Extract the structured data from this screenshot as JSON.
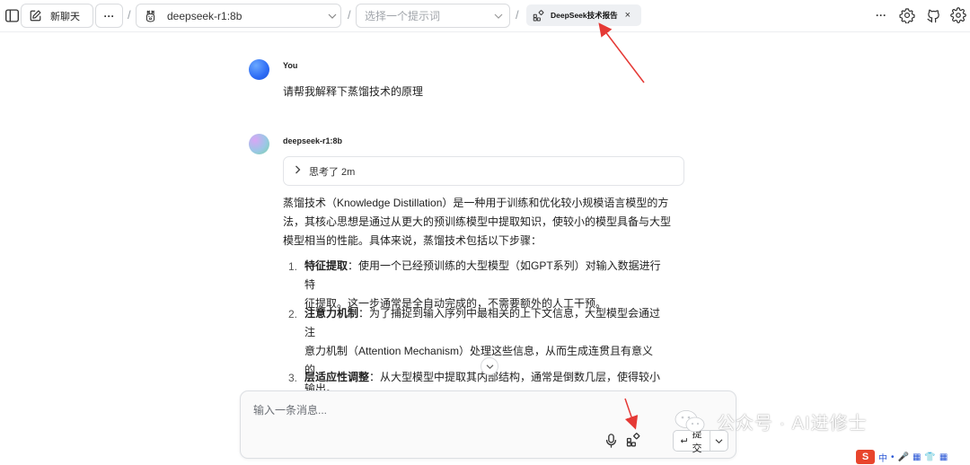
{
  "topbar": {
    "new_chat_label": "新聊天",
    "more_label": "···",
    "separator": "/",
    "model_name": "deepseek-r1:8b",
    "prompt_placeholder": "选择一个提示词",
    "kb_chip_label": "DeepSeek技术报告",
    "kb_close": "×"
  },
  "chat": {
    "user_name": "You",
    "user_message": "请帮我解释下蒸馏技术的原理",
    "bot_name": "deepseek-r1:8b",
    "thinking_label": "思考了 2m",
    "intro_lines": [
      "蒸馏技术（Knowledge Distillation）是一种用于训练和优化较小规模语言模型的方",
      "法，其核心思想是通过从更大的预训练模型中提取知识，使较小的模型具备与大型",
      "模型相当的性能。具体来说，蒸馏技术包括以下步骤："
    ],
    "steps": [
      {
        "num": "1.",
        "title": "特征提取",
        "lines": [
          "：使用一个已经预训练的大型模型（如GPT系列）对输入数据进行特",
          "征提取。这一步通常是全自动完成的，不需要额外的人工干预。"
        ]
      },
      {
        "num": "2.",
        "title": "注意力机制",
        "lines": [
          "：为了捕捉到输入序列中最相关的上下文信息，大型模型会通过注",
          "意力机制（Attention Mechanism）处理这些信息，从而生成连贯且有意义的",
          "输出。"
        ]
      },
      {
        "num": "3.",
        "title": "层适应性调整",
        "lines": [
          "：从大型模型中提取其内部结构，通常是倒数几层，使得较小的"
        ]
      }
    ]
  },
  "input": {
    "placeholder": "输入一条消息...",
    "submit_label": "提 交"
  },
  "overlay": {
    "watermark_text": "公众号 · AI进修士",
    "ime_items": [
      "中",
      "•",
      "🎤",
      "▦",
      "👕",
      "▦"
    ]
  },
  "colors": {
    "arrow_red": "#e53935",
    "ime_brand": "#e8452c"
  }
}
